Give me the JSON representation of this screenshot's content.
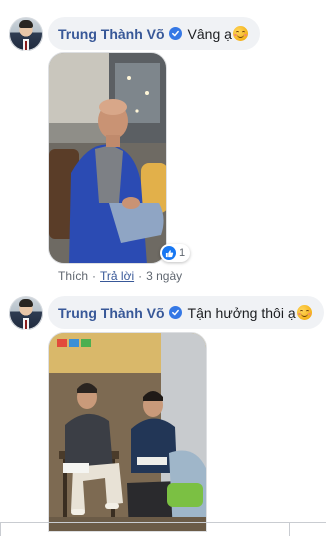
{
  "comments": [
    {
      "author": "Trung Thành Võ",
      "text": "Vâng ạ",
      "emoji": "smiling-blush-emoji",
      "reaction": {
        "icon": "like-icon",
        "count": "1"
      },
      "actions": {
        "like": "Thích",
        "reply": "Trả lời",
        "time": "3 ngày"
      }
    },
    {
      "author": "Trung Thành Võ",
      "text": "Tận hưởng thôi ạ",
      "emoji": "relieved-emoji"
    }
  ],
  "colors": {
    "name": "#385898",
    "bubble": "#f0f2f5",
    "verified": "#3578e5",
    "like": "#1877f2"
  }
}
